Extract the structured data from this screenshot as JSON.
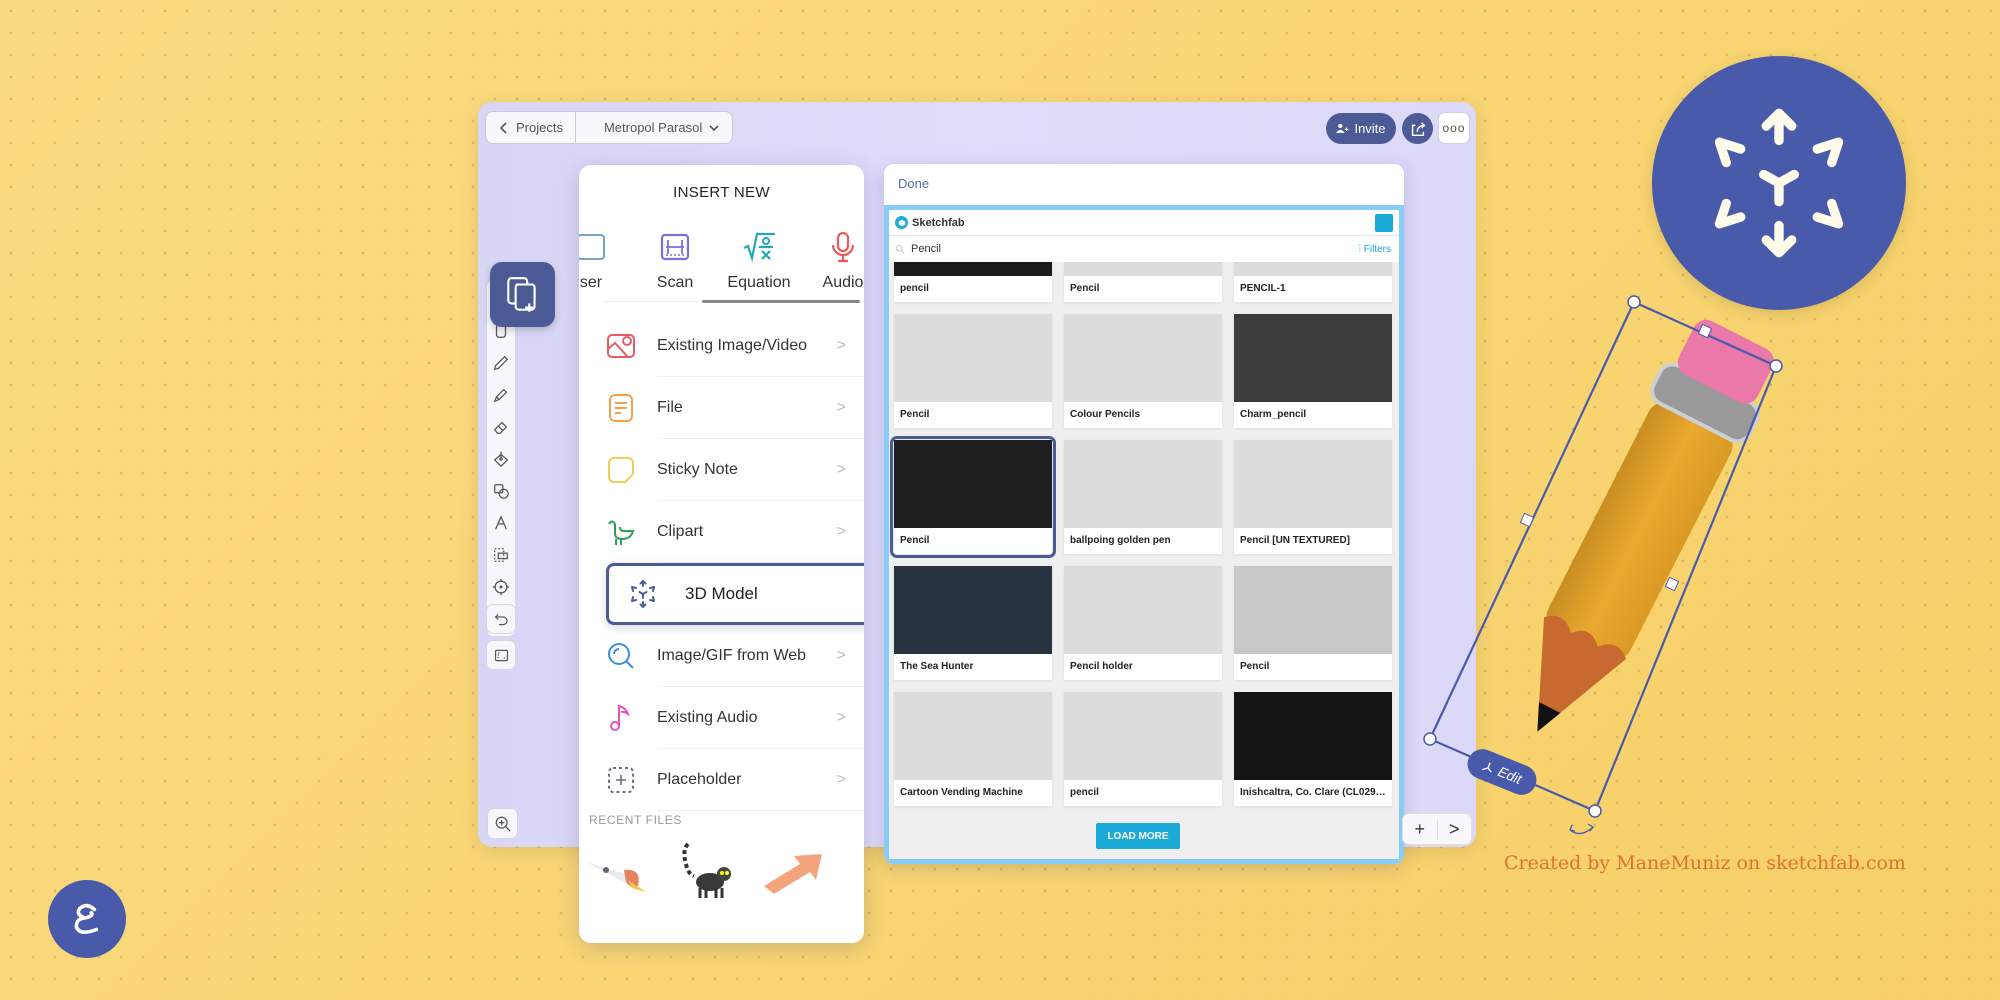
{
  "topbar": {
    "back_label": "Projects",
    "project_name": "Metropol Parasol",
    "invite_label": "Invite",
    "more_label": "ooo"
  },
  "toolbar": {
    "tools": [
      "select-icon",
      "pen-icon",
      "highlighter-icon",
      "eraser-icon",
      "fill-icon",
      "shapes-icon",
      "text-icon",
      "lasso-icon",
      "laser-pointer-icon"
    ],
    "undo": "undo-icon",
    "frame": "frame-icon",
    "zoom": "zoom-in-icon"
  },
  "insert_menu": {
    "title": "INSERT NEW",
    "quick_items": [
      {
        "label": "ser",
        "icon": "browser-icon",
        "color": "#7aa0c8"
      },
      {
        "label": "Scan",
        "icon": "scan-icon",
        "color": "#7b6fe0"
      },
      {
        "label": "Equation",
        "icon": "equation-icon",
        "color": "#22a9b5"
      },
      {
        "label": "Audio",
        "icon": "microphone-icon",
        "color": "#ec5a5a"
      }
    ],
    "items": [
      {
        "label": "Existing Image/Video",
        "icon": "image-icon",
        "color": "#e85a66"
      },
      {
        "label": "File",
        "icon": "file-icon",
        "color": "#f1a346"
      },
      {
        "label": "Sticky Note",
        "icon": "sticky-note-icon",
        "color": "#f0cd5a"
      },
      {
        "label": "Clipart",
        "icon": "bird-icon",
        "color": "#2fa052"
      },
      {
        "label": "3D Model",
        "icon": "3d-model-icon",
        "color": "#4c5a96",
        "selected": true
      },
      {
        "label": "Image/GIF from Web",
        "icon": "search-icon",
        "color": "#3c8ee0"
      },
      {
        "label": "Existing Audio",
        "icon": "music-note-icon",
        "color": "#e055b8"
      },
      {
        "label": "Placeholder",
        "icon": "placeholder-icon",
        "color": "#6c6f80"
      }
    ],
    "chevron": ">",
    "recent_label": "RECENT FILES",
    "recent_files": [
      "rocket-clipart",
      "lemur-clipart",
      "arrow-clipart",
      "partial-clipart"
    ]
  },
  "sketchfab": {
    "done_label": "Done",
    "brand": "Sketchfab",
    "search_value": "Pencil",
    "filters_label": "Filters",
    "load_more_label": "LOAD MORE",
    "results": [
      {
        "title": "pencil",
        "bg": "#1c1c1c"
      },
      {
        "title": "Pencil",
        "bg": "#dcdcdc"
      },
      {
        "title": "PENCIL-1",
        "bg": "#dcdcdc"
      },
      {
        "title": "Pencil",
        "bg": "#dcdcdc"
      },
      {
        "title": "Colour Pencils",
        "bg": "#dcdcdc"
      },
      {
        "title": "Charm_pencil",
        "bg": "#3c3c3c"
      },
      {
        "title": "Pencil",
        "bg": "#1e1e1e",
        "selected": true
      },
      {
        "title": "ballpoing golden pen",
        "bg": "#dcdcdc"
      },
      {
        "title": "Pencil [UN TEXTURED]",
        "bg": "#dcdcdc"
      },
      {
        "title": "The Sea Hunter",
        "bg": "#2a3340"
      },
      {
        "title": "Pencil holder",
        "bg": "#dcdcdc"
      },
      {
        "title": "Pencil",
        "bg": "#c8c8c8"
      },
      {
        "title": "Cartoon Vending Machine",
        "bg": "#dcdcdc"
      },
      {
        "title": "pencil",
        "bg": "#dcdcdc"
      },
      {
        "title": "Inishcaltra, Co. Clare (CL029-0...",
        "bg": "#141414"
      }
    ]
  },
  "canvas": {
    "edit_label": "Edit",
    "add_page_label": "+",
    "next_page_label": ">"
  },
  "credit_text": "Created by ManeMuniz on sketchfab.com",
  "colors": {
    "accent": "#4c5a96",
    "hero": "#4a5aaa",
    "sketchfab": "#1caad9",
    "credit": "#e0703a",
    "background": "#f9d87a"
  }
}
